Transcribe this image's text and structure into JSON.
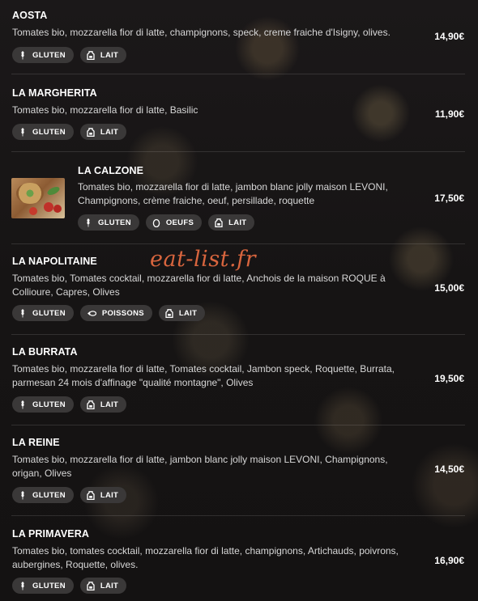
{
  "watermark": "eat-list.fr",
  "badges": {
    "gluten": "GLUTEN",
    "lait": "LAIT",
    "oeufs": "OEUFS",
    "poissons": "POISSONS"
  },
  "items": [
    {
      "name": "AOSTA",
      "desc": "Tomates bio, mozzarella fior di latte, champignons, speck, creme fraiche d'Isigny, olives.",
      "price": "14,90€",
      "badges": [
        "gluten",
        "lait"
      ]
    },
    {
      "name": "LA MARGHERITA",
      "desc": "Tomates bio, mozzarella fior di latte, Basilic",
      "price": "11,90€",
      "badges": [
        "gluten",
        "lait"
      ]
    },
    {
      "name": "LA CALZONE",
      "desc": "Tomates bio, mozzarella fior di latte, jambon blanc jolly maison LEVONI, Champignons, crème fraiche, oeuf, persillade, roquette",
      "price": "17,50€",
      "badges": [
        "gluten",
        "oeufs",
        "lait"
      ],
      "has_image": true
    },
    {
      "name": "LA NAPOLITAINE",
      "desc": "Tomates bio, Tomates cocktail, mozzarella fior di latte, Anchois de la maison ROQUE à Collioure, Capres, Olives",
      "price": "15,00€",
      "badges": [
        "gluten",
        "poissons",
        "lait"
      ]
    },
    {
      "name": "LA BURRATA",
      "desc": "Tomates bio, mozzarella fior di latte, Tomates cocktail, Jambon speck, Roquette, Burrata, parmesan 24 mois d'affinage \"qualité montagne\", Olives",
      "price": "19,50€",
      "badges": [
        "gluten",
        "lait"
      ]
    },
    {
      "name": "LA REINE",
      "desc": "Tomates bio, mozzarella fior di latte, jambon blanc jolly maison LEVONI, Champignons, origan, Olives",
      "price": "14,50€",
      "badges": [
        "gluten",
        "lait"
      ]
    },
    {
      "name": "LA PRIMAVERA",
      "desc": "Tomates bio, tomates cocktail, mozzarella fior di latte, champignons, Artichauds, poivrons, aubergines, Roquette, olives.",
      "price": "16,90€",
      "badges": [
        "gluten",
        "lait"
      ]
    }
  ]
}
